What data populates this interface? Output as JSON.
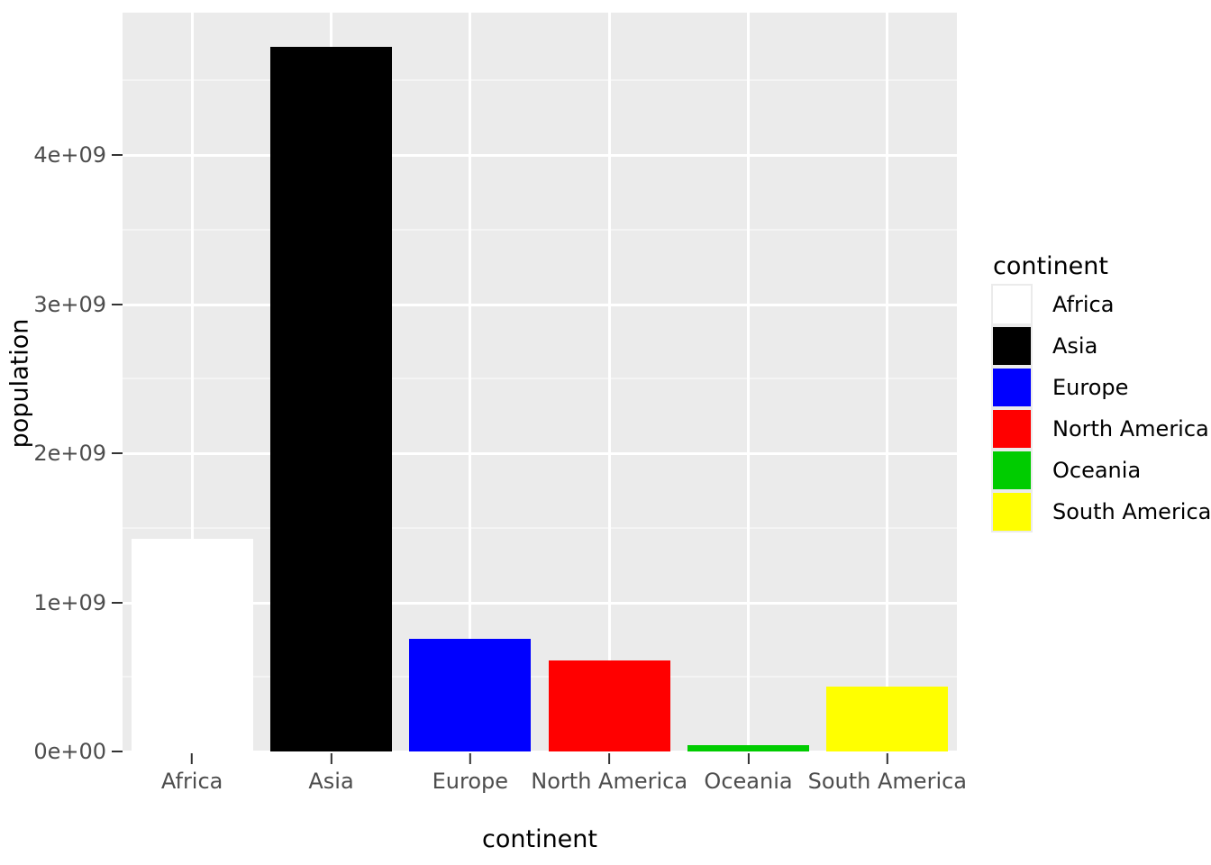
{
  "chart_data": {
    "type": "bar",
    "title": "",
    "subtitle": "",
    "xlabel": "continent",
    "ylabel": "population",
    "categories": [
      "Africa",
      "Asia",
      "Europe",
      "North America",
      "Oceania",
      "South America"
    ],
    "values": [
      1426000000,
      4725000000,
      755000000,
      610000000,
      42000000,
      435000000
    ],
    "series": [
      {
        "name": "population",
        "values": [
          1426000000,
          4725000000,
          755000000,
          610000000,
          42000000,
          435000000
        ]
      }
    ],
    "colors": [
      "#ffffff",
      "#000000",
      "#0000ff",
      "#ff0000",
      "#00cc00",
      "#ffff00"
    ],
    "ylim": [
      0,
      4900000000
    ],
    "ytick_values": [
      0,
      1000000000,
      2000000000,
      3000000000,
      4000000000
    ],
    "ytick_labels": [
      "0e+00",
      "1e+09",
      "2e+09",
      "3e+09",
      "4e+09"
    ],
    "grid": true,
    "legend_position": "right",
    "legend": {
      "title": "continent",
      "entries": [
        {
          "label": "Africa",
          "color": "#ffffff"
        },
        {
          "label": "Asia",
          "color": "#000000"
        },
        {
          "label": "Europe",
          "color": "#0000ff"
        },
        {
          "label": "North America",
          "color": "#ff0000"
        },
        {
          "label": "Oceania",
          "color": "#00cc00"
        },
        {
          "label": "South America",
          "color": "#ffff00"
        }
      ]
    },
    "theme": {
      "panel_background": "#ebebeb",
      "grid_major": "#ffffff",
      "grid_minor": "#f4f4f4",
      "axis_text": "#4d4d4d",
      "axis_title": "#000000",
      "plot_background": "#ffffff"
    }
  },
  "axis": {
    "y_title": "population",
    "x_title": "continent",
    "y_labels": [
      "0e+00",
      "1e+09",
      "2e+09",
      "3e+09",
      "4e+09"
    ],
    "x_labels": [
      "Africa",
      "Asia",
      "Europe",
      "North America",
      "Oceania",
      "South America"
    ]
  },
  "legend": {
    "title": "continent",
    "items": [
      {
        "label": "Africa"
      },
      {
        "label": "Asia"
      },
      {
        "label": "Europe"
      },
      {
        "label": "North America"
      },
      {
        "label": "Oceania"
      },
      {
        "label": "South America"
      }
    ]
  }
}
